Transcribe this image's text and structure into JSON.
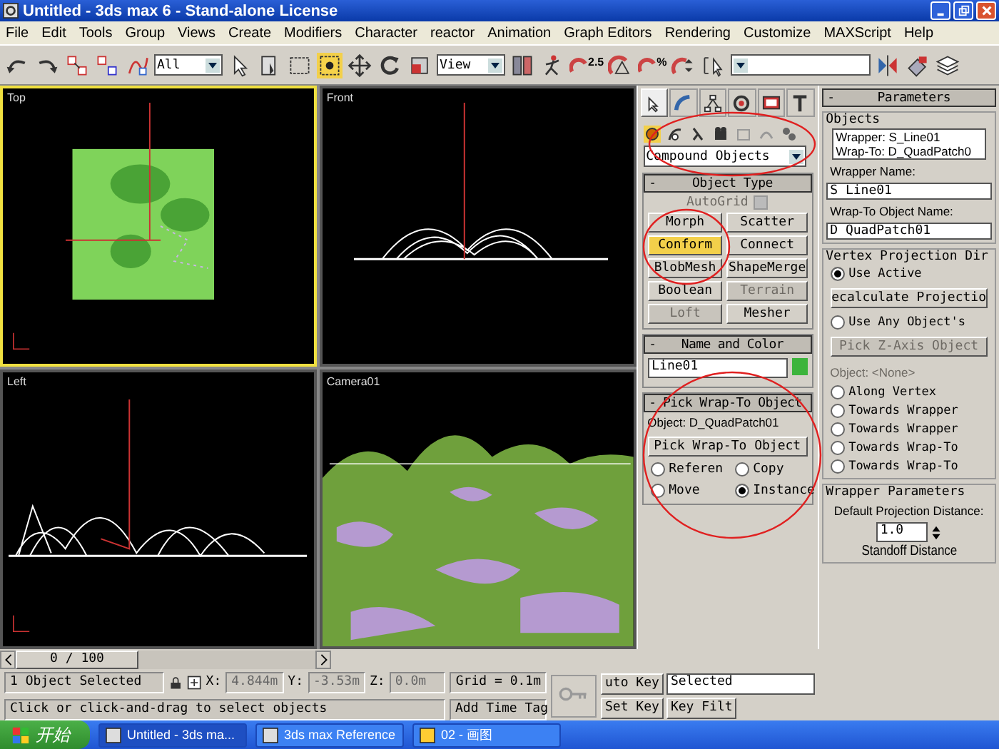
{
  "window": {
    "title": "Untitled - 3ds max 6 - Stand-alone License"
  },
  "menu": [
    "File",
    "Edit",
    "Tools",
    "Group",
    "Views",
    "Create",
    "Modifiers",
    "Character",
    "reactor",
    "Animation",
    "Graph Editors",
    "Rendering",
    "Customize",
    "MAXScript",
    "Help"
  ],
  "toolbar": {
    "selection_filter": "All",
    "reference_coord": "View",
    "angle_snap_label": "2.5",
    "percent_snap_label": "%"
  },
  "viewports": [
    {
      "label": "Top",
      "kind": "top",
      "selected": true
    },
    {
      "label": "Front",
      "kind": "front",
      "selected": false
    },
    {
      "label": "Left",
      "kind": "left",
      "selected": false
    },
    {
      "label": "Camera01",
      "kind": "camera",
      "selected": false
    }
  ],
  "command_panel": {
    "tabs": [
      {
        "selected": true
      },
      {
        "selected": false
      },
      {
        "selected": false
      },
      {
        "selected": false
      },
      {
        "selected": false
      },
      {
        "selected": false
      }
    ],
    "categories": [
      {
        "selected": true
      },
      {
        "selected": false
      },
      {
        "selected": false
      },
      {
        "selected": false
      },
      {
        "selected": false
      },
      {
        "selected": false
      },
      {
        "selected": false
      }
    ],
    "dropdown": "Compound Objects",
    "object_type": {
      "sign": "-",
      "title": "Object Type",
      "autogrid": {
        "label": "AutoGrid",
        "checked": false,
        "disabled": true
      },
      "buttons": [
        {
          "label": "Morph",
          "selected": false,
          "disabled": false
        },
        {
          "label": "Scatter",
          "selected": false,
          "disabled": false
        },
        {
          "label": "Conform",
          "selected": true,
          "disabled": false
        },
        {
          "label": "Connect",
          "selected": false,
          "disabled": false
        },
        {
          "label": "BlobMesh",
          "selected": false,
          "disabled": false
        },
        {
          "label": "ShapeMerge",
          "selected": false,
          "disabled": false
        },
        {
          "label": "Boolean",
          "selected": false,
          "disabled": false
        },
        {
          "label": "Terrain",
          "selected": false,
          "disabled": true
        },
        {
          "label": "Loft",
          "selected": false,
          "disabled": true
        },
        {
          "label": "Mesher",
          "selected": false,
          "disabled": false
        }
      ]
    },
    "name_color": {
      "sign": "-",
      "title": "Name and Color",
      "name": "Line01",
      "color": "#3cb43c"
    },
    "pick": {
      "sign": "-",
      "title": "Pick Wrap-To Object",
      "object": "Object: D_QuadPatch01",
      "button": "Pick Wrap-To Object",
      "options": [
        {
          "label": "Referen",
          "selected": false
        },
        {
          "label": "Copy",
          "selected": false
        },
        {
          "label": "Move",
          "selected": false
        },
        {
          "label": "Instance",
          "selected": true
        }
      ]
    }
  },
  "parameters": {
    "sign": "-",
    "title": "Parameters",
    "objects_group": "Objects",
    "objects_list": [
      "Wrapper: S_Line01",
      "Wrap-To: D_QuadPatch0"
    ],
    "wrapper_name_label": "Wrapper Name:",
    "wrapper_name": "S Line01",
    "wrapto_name_label": "Wrap-To Object Name:",
    "wrapto_name": "D QuadPatch01",
    "projection_group": "Vertex Projection Dir",
    "projection": [
      {
        "kind": "radio",
        "label": "Use Active",
        "selected": true
      },
      {
        "kind": "button",
        "label": "ecalculate Projectio",
        "disabled": false
      },
      {
        "kind": "radio",
        "label": "Use Any Object's",
        "selected": false
      },
      {
        "kind": "button",
        "label": "Pick Z-Axis Object",
        "disabled": true
      },
      {
        "kind": "text",
        "label": "Object: <None>",
        "disabled": true
      },
      {
        "kind": "radio",
        "label": "Along Vertex",
        "selected": false
      },
      {
        "kind": "radio",
        "label": "Towards Wrapper",
        "selected": false
      },
      {
        "kind": "radio",
        "label": "Towards Wrapper",
        "selected": false
      },
      {
        "kind": "radio",
        "label": "Towards Wrap-To",
        "selected": false
      },
      {
        "kind": "radio",
        "label": "Towards Wrap-To",
        "selected": false
      }
    ],
    "wrapper_group": "Wrapper Parameters",
    "distance_label": "Default Projection Distance:",
    "distance": "1.0",
    "standoff_label": "Standoff Distance"
  },
  "timeline": {
    "position": "0 / 100",
    "level": 0
  },
  "status": {
    "selection": "1 Object Selected",
    "x_label": "X:",
    "x": "4.844m",
    "y_label": "Y:",
    "y": "-3.53m",
    "z_label": "Z:",
    "z": "0.0m",
    "grid": "Grid = 0.1m",
    "auto_key": "uto Key",
    "key_mode": "Selected",
    "set_key": "Set Key",
    "key_filters": "Key Filt",
    "prompt": "Click or click-and-drag to select objects",
    "time_tag": "Add Time Tag"
  },
  "taskbar": {
    "start": "开始",
    "tasks": [
      {
        "label": "Untitled - 3ds ma...",
        "selected": true
      },
      {
        "label": "3ds max Reference",
        "selected": false
      },
      {
        "label": "02 - 画图",
        "selected": false
      }
    ]
  }
}
